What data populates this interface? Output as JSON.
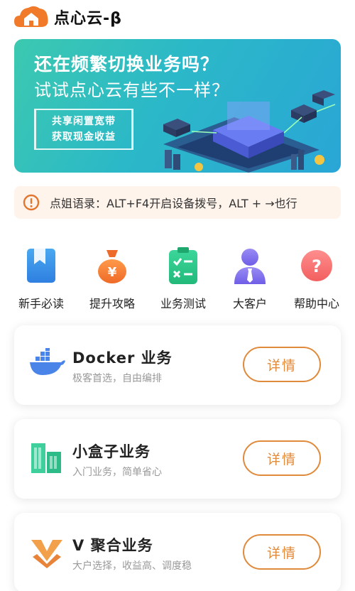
{
  "header": {
    "title": "点心云-β",
    "logo_icon": "house-cloud-logo-icon"
  },
  "banner": {
    "headline": "还在频繁切换业务吗？",
    "subline": "试试点心云有些不一样？",
    "box_line1": "共享闲置宽带",
    "box_line2": "获取现金收益"
  },
  "notice": {
    "icon": "alert-circle-icon",
    "text": "点姐语录：ALT+F4开启设备拨号，ALT + →也行"
  },
  "quick_links": [
    {
      "label": "新手必读",
      "icon": "bookmark-book-icon"
    },
    {
      "label": "提升攻略",
      "icon": "money-bag-icon"
    },
    {
      "label": "业务测试",
      "icon": "checklist-clipboard-icon"
    },
    {
      "label": "大客户",
      "icon": "user-tie-icon"
    },
    {
      "label": "帮助中心",
      "icon": "question-circle-icon"
    }
  ],
  "services": [
    {
      "title": "Docker 业务",
      "subtitle": "极客首选，自由编排",
      "button": "详情",
      "icon": "docker-whale-icon"
    },
    {
      "title": "小盒子业务",
      "subtitle": "入门业务，简单省心",
      "button": "详情",
      "icon": "server-box-icon"
    },
    {
      "title": "V 聚合业务",
      "subtitle": "大户选择，收益高、调度稳",
      "button": "详情",
      "icon": "v-funnel-icon"
    }
  ],
  "colors": {
    "accent": "#e08a3c",
    "brand": "#f07a2a",
    "banner_start": "#3cc9b0",
    "banner_end": "#2aa6d6"
  }
}
